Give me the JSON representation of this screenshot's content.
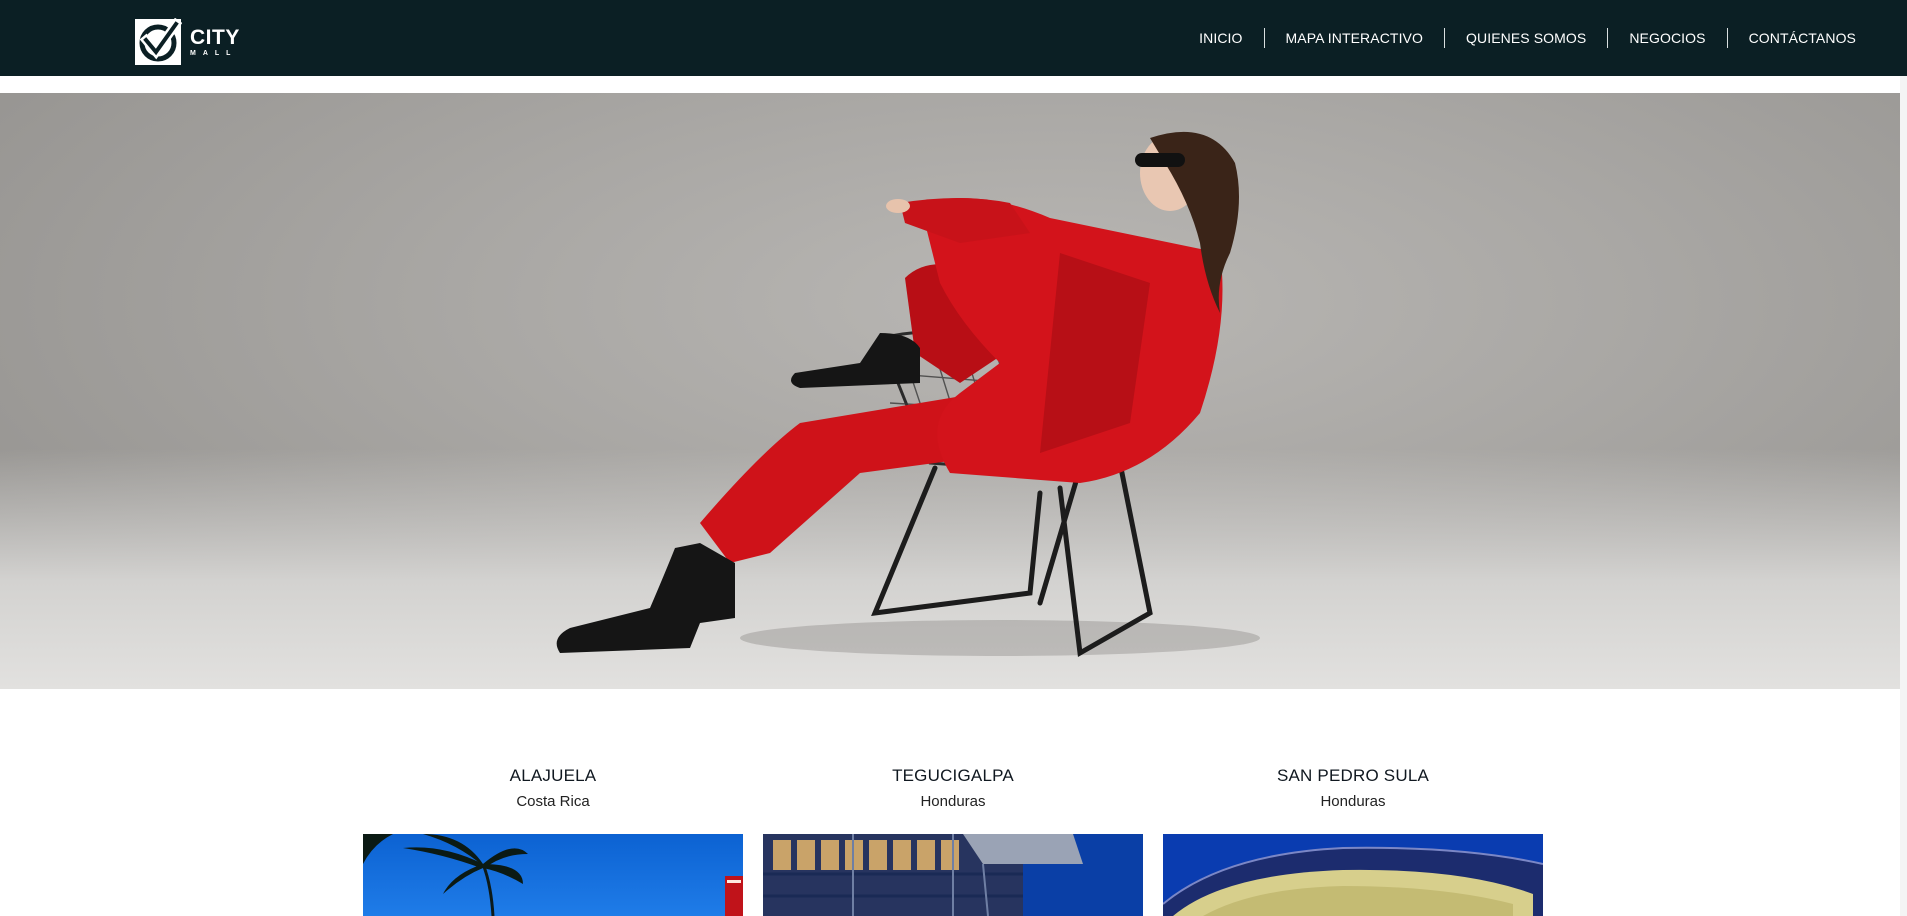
{
  "header": {
    "logo": {
      "word": "CITY",
      "sub": "MALL",
      "icon": "city-mall-check-logo"
    },
    "nav": [
      {
        "label": "INICIO"
      },
      {
        "label": "MAPA INTERACTIVO"
      },
      {
        "label": "QUIENES SOMOS"
      },
      {
        "label": "NEGOCIOS"
      },
      {
        "label": "CONTÁCTANOS"
      }
    ]
  },
  "hero": {
    "description_icon": "hero-banner-image"
  },
  "locations": [
    {
      "name": "ALAJUELA",
      "country": "Costa Rica"
    },
    {
      "name": "TEGUCIGALPA",
      "country": "Honduras"
    },
    {
      "name": "SAN PEDRO SULA",
      "country": "Honduras"
    }
  ],
  "colors": {
    "header_bg": "#0b1f24",
    "accent_red": "#d3131b",
    "text_dark": "#101820"
  }
}
